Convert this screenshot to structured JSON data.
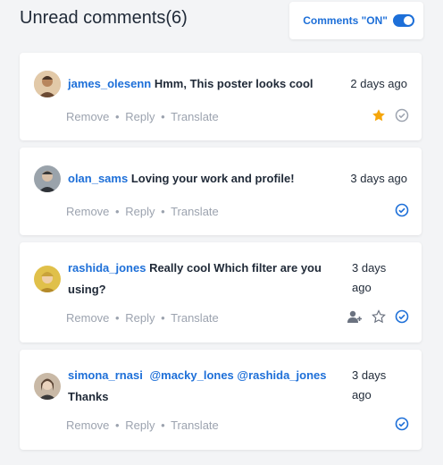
{
  "header": {
    "title": "Unread comments(6)",
    "toggle_label": "Comments \"ON\"",
    "toggle_on": true
  },
  "actions": {
    "remove": "Remove",
    "reply": "Reply",
    "translate": "Translate",
    "separator": "•"
  },
  "comments": [
    {
      "user": "james_olesenn",
      "text": "Hmm, This poster looks cool",
      "time": "2 days ago",
      "icons": [
        "star-filled-icon",
        "check-circle-grey-icon"
      ]
    },
    {
      "user": "olan_sams",
      "text": "Loving your work and profile!",
      "time": "3 days ago",
      "icons": [
        "check-circle-blue-icon"
      ]
    },
    {
      "user": "rashida_jones",
      "text_line1": "Really cool Which filter are you",
      "text_line2": "using?",
      "time_line1": "3 days",
      "time_line2": "ago",
      "icons": [
        "add-user-icon",
        "star-outline-icon",
        "check-circle-blue-icon"
      ]
    },
    {
      "user": "simona_rnasi",
      "mentions": "@macky_lones @rashida_jones",
      "text": "Thanks",
      "time_line1": "3 days",
      "time_line2": "ago",
      "icons": [
        "check-circle-blue-icon"
      ]
    }
  ],
  "colors": {
    "accent": "#1d6fd8",
    "star": "#f5a60b",
    "muted": "#9ca3af"
  }
}
